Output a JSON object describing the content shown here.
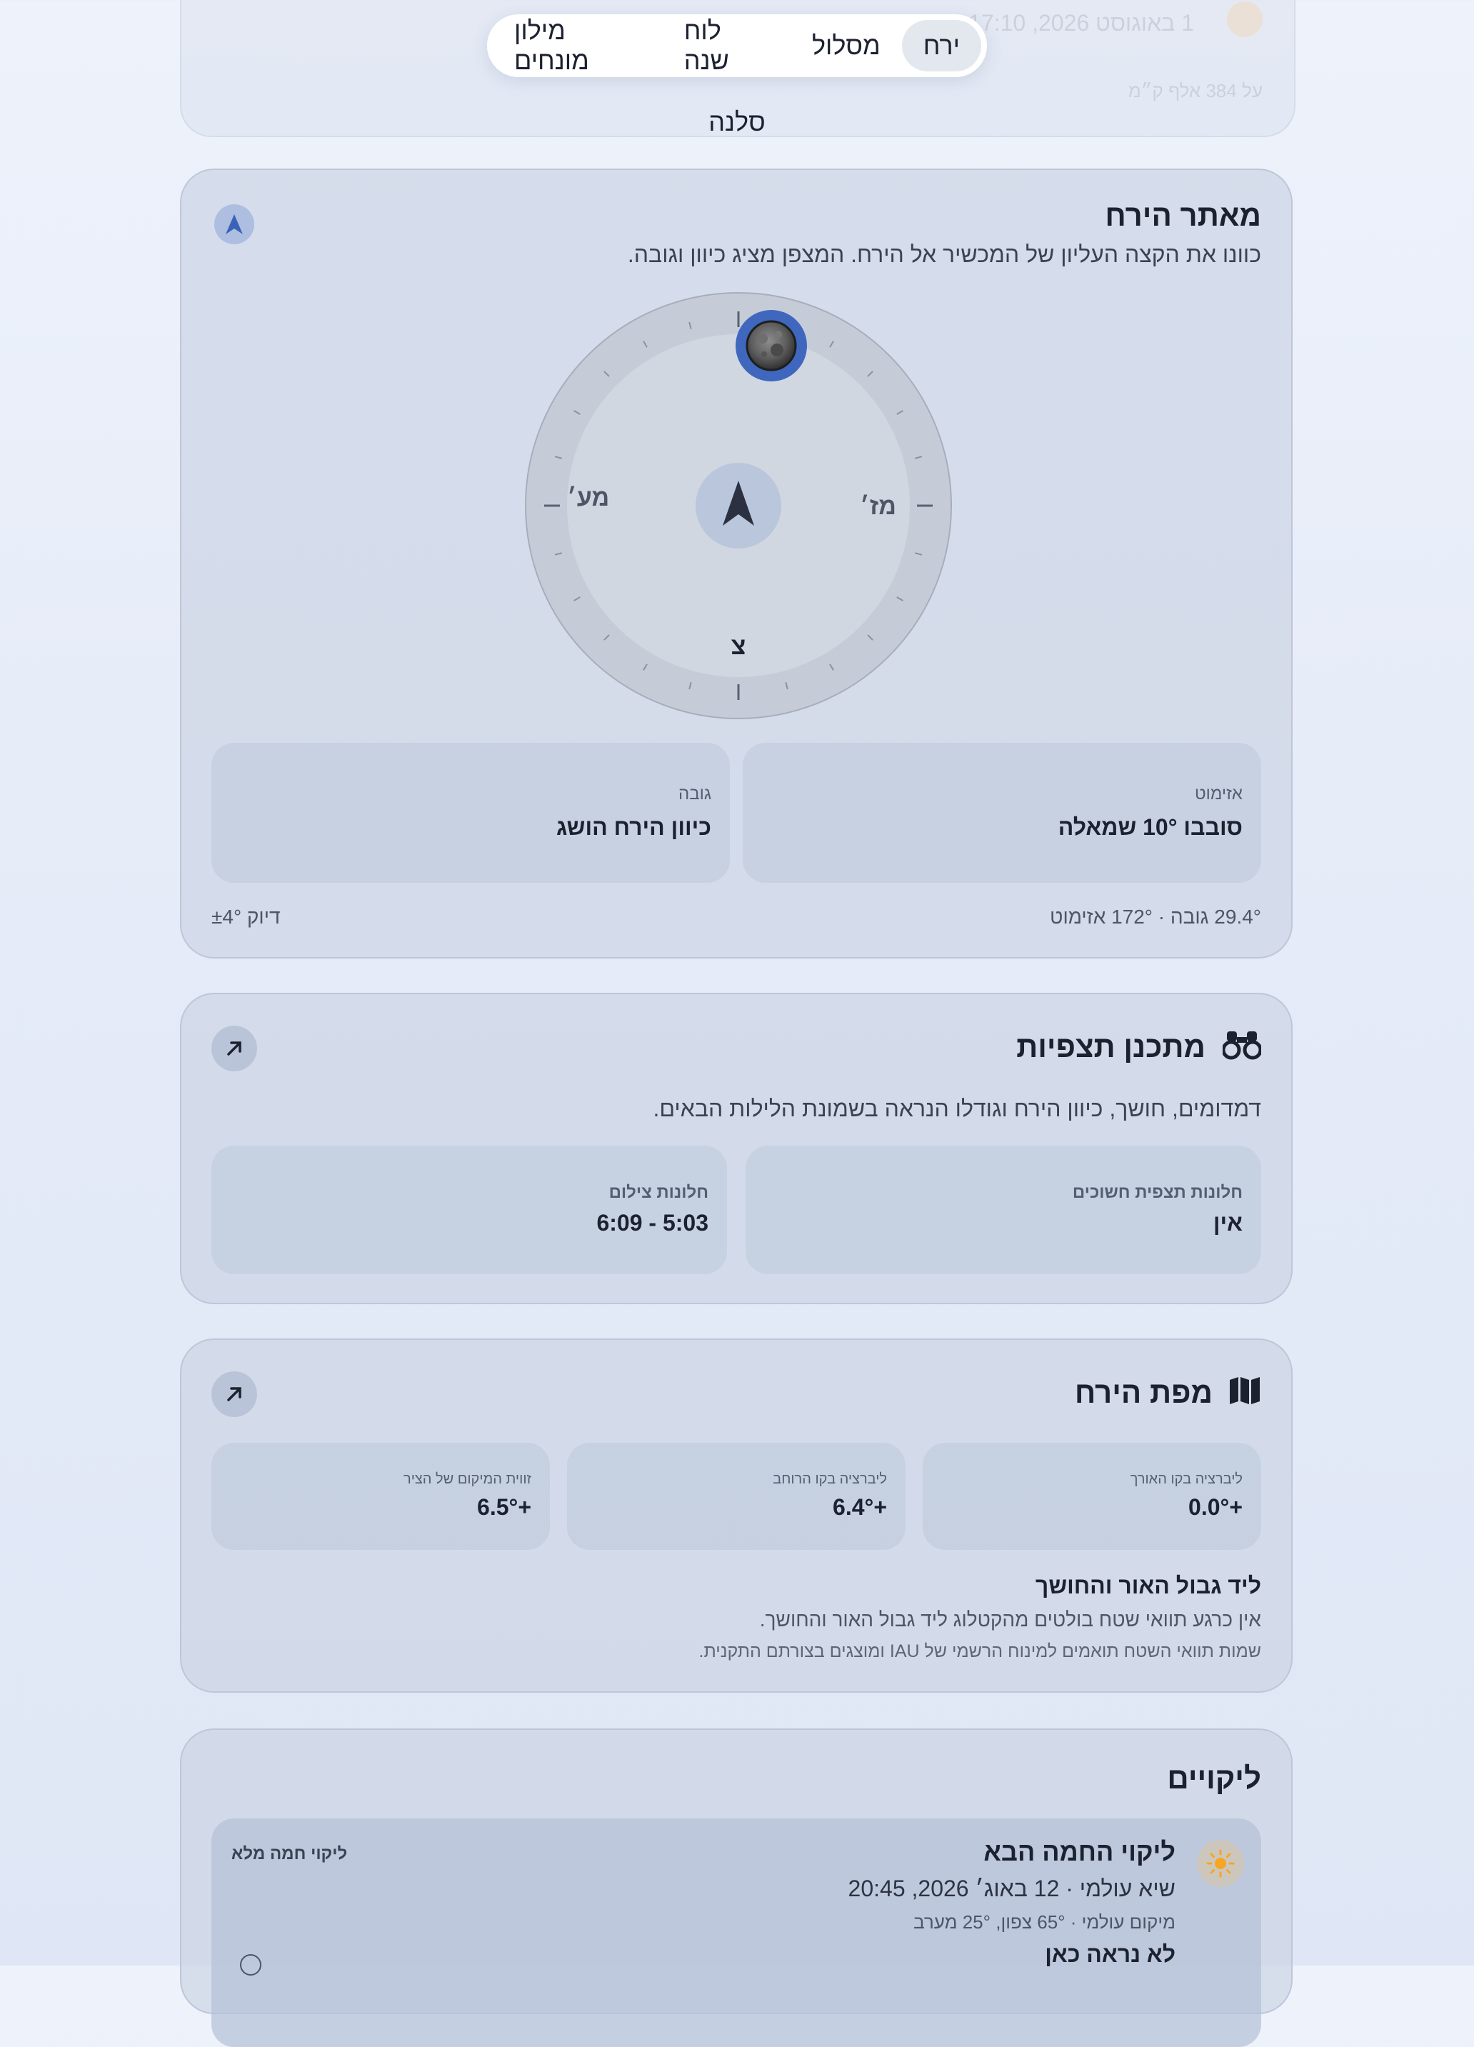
{
  "tabs": [
    {
      "label": "ירח",
      "active": true
    },
    {
      "label": "מסלול",
      "active": false
    },
    {
      "label": "לוח שנה",
      "active": false
    },
    {
      "label": "מילון מונחים",
      "active": false
    }
  ],
  "page_subtitle": "סלנה",
  "moon_finder": {
    "title": "מאתר הירח",
    "description": "כוונו את הקצה העליון של המכשיר אל הירח. המצפן מציג כיוון וגובה.",
    "compass": {
      "north": "צ",
      "east": "מז׳",
      "west": "מע׳"
    },
    "azimuth": {
      "label": "אזימוט",
      "value": "סובבו 10° שמאלה"
    },
    "altitude": {
      "label": "גובה",
      "value": "כיוון הירח הושג"
    },
    "readout": "29.4° גובה · 172° אזימוט",
    "accuracy": "דיוק ±4°"
  },
  "planner": {
    "title": "מתכנן תצפיות",
    "icon": "binoculars-icon",
    "description": "דמדומים, חושך, כיוון הירח וגודלו הנראה בשמונת הלילות הבאים.",
    "dark_windows": {
      "label": "חלונות תצפית חשוכים",
      "value": "אין"
    },
    "photo_windows": {
      "label": "חלונות צילום",
      "value": "5:03 - 6:09"
    }
  },
  "moon_map": {
    "title": "מפת הירח",
    "icon": "map-icon",
    "lon_libration": {
      "label": "ליברציה בקו האורך",
      "value": "+0.0°"
    },
    "lat_libration": {
      "label": "ליברציה בקו הרוחב",
      "value": "+6.4°"
    },
    "pos_angle": {
      "label": "זווית המיקום של הציר",
      "value": "+6.5°"
    },
    "terminator_title": "ליד גבול האור והחושך",
    "terminator_text": "אין כרגע תוואי שטח בולטים מהקטלוג ליד גבול האור והחושך.",
    "terminator_note": "שמות תוואי השטח תואמים למינוח הרשמי של IAU ומוצגים בצורתם התקנית."
  },
  "eclipses": {
    "title": "ליקויים",
    "next_title": "ליקוי החמה הבא",
    "next_badge": "ליקוי חמה מלא",
    "next_peak": "שיא עולמי · 12 באוג׳ 2026, 20:45",
    "next_location": "מיקום עולמי · 65° צפון, 25° מערב",
    "visibility": "לא נראה כאן"
  },
  "ghost": {
    "date": "1 באוגוסט 2026, 17:10",
    "distance": "על 384 אלף ק״מ"
  }
}
